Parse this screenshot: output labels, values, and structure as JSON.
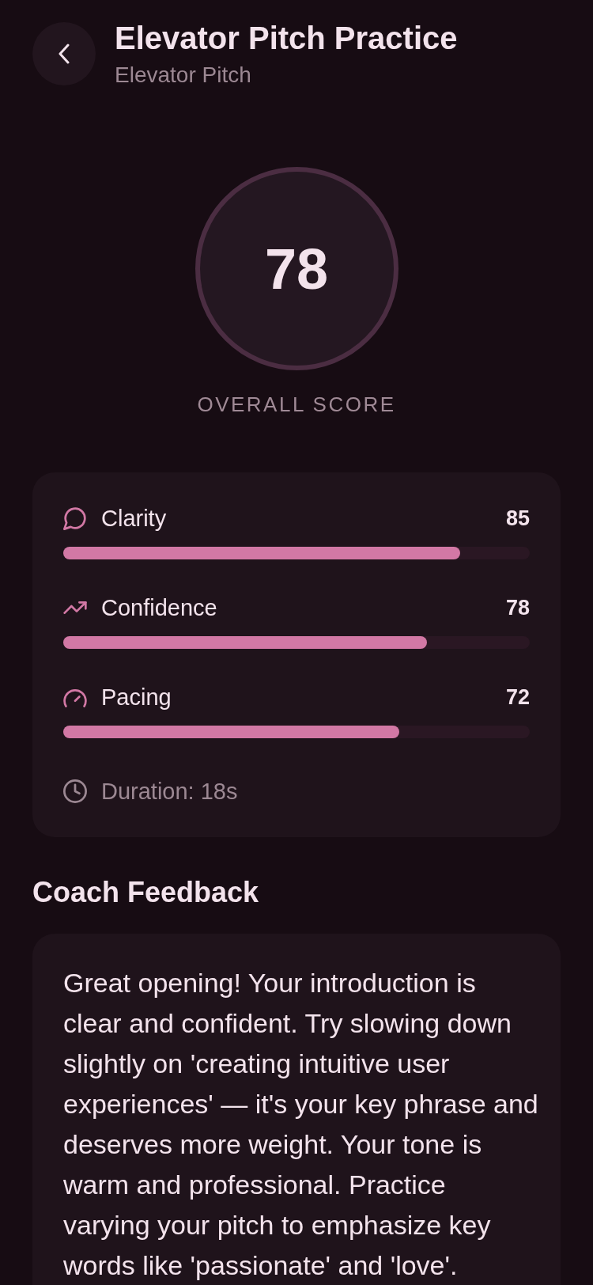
{
  "header": {
    "title": "Elevator Pitch Practice",
    "subtitle": "Elevator Pitch"
  },
  "score": {
    "value": "78",
    "label": "OVERALL SCORE"
  },
  "metrics": [
    {
      "kind": "clarity",
      "label": "Clarity",
      "value": "85",
      "level": 0.85
    },
    {
      "kind": "confidence",
      "label": "Confidence",
      "value": "78",
      "level": 0.78
    },
    {
      "kind": "pacing",
      "label": "Pacing",
      "value": "72",
      "level": 0.72
    }
  ],
  "duration": "Duration: 18s",
  "feedback": {
    "title": "Coach Feedback",
    "text": "Great opening! Your introduction is clear and confident. Try slowing down slightly on 'creating intuitive user experiences' — it's your key phrase and deserves more weight. Your tone is warm and professional. Practice varying your pitch to emphasize key words like 'passionate' and 'love'."
  }
}
